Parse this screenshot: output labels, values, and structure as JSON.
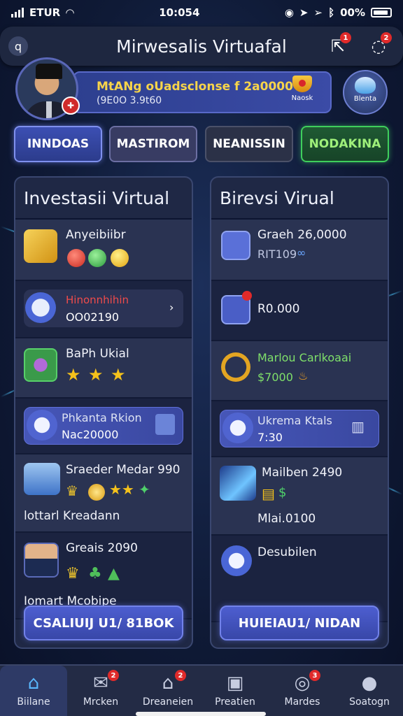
{
  "status_bar": {
    "carrier": "ETUR",
    "time": "10:054",
    "battery": "00%"
  },
  "header": {
    "title": "Mirwesalis Virtuafal",
    "back_icon": "q",
    "badge_count_1": "1",
    "badge_count_2": "2"
  },
  "profile": {
    "line1": "MtANg oUadsclonse f 2a0000",
    "line2": "(9E0O 3.9t60",
    "trophy_label": "Naosk",
    "badge_label": "Blenta",
    "avatar_badge_icon": "shield"
  },
  "tabs": [
    "INNDOAS",
    "MASTIROM",
    "NEANISSIN",
    "NODAKINA"
  ],
  "left_panel": {
    "title": "Investasii Virtual",
    "rows": [
      {
        "title": "Anyeibiibr"
      },
      {
        "title": "Hinonnhihin",
        "subtitle": "OO02190",
        "title_color": "#e03a3a"
      },
      {
        "title": "BaPh Ukial"
      },
      {
        "title": "Phkanta Rkion",
        "subtitle": "Nac20000"
      },
      {
        "title": "Sraeder Medar 990",
        "subtitle": "lottarl Kreadann"
      },
      {
        "title": "Greais 2090",
        "subtitle": "Iomart Mcobipe"
      }
    ],
    "button": "CSALIUIJ U1/ 81BOK"
  },
  "right_panel": {
    "title": "Birevsi Virual",
    "rows": [
      {
        "title": "Graeh 26,0000",
        "subtitle": "RIT109"
      },
      {
        "title": "R0.000"
      },
      {
        "title": "Marlou Carlkoaai",
        "subtitle": "$7000",
        "title_color": "#7fe06a",
        "subtitle_color": "#7fe06a"
      },
      {
        "title": "Ukrema Ktals",
        "subtitle": "7:30"
      },
      {
        "title": "Mailben 2490",
        "subtitle": "Mlai.0100"
      },
      {
        "title": "Desubilen"
      }
    ],
    "button": "HUIEIAU1/ NIDAN"
  },
  "bottom_nav": [
    {
      "label": "Biilane",
      "icon": "home-icon",
      "active": true
    },
    {
      "label": "Mrcken",
      "icon": "mail-icon",
      "badge": "2"
    },
    {
      "label": "Dreaneien",
      "icon": "house-icon",
      "badge": "2"
    },
    {
      "label": "Preatien",
      "icon": "briefcase-icon"
    },
    {
      "label": "Mardes",
      "icon": "target-icon",
      "badge": "3"
    },
    {
      "label": "Soatogn",
      "icon": "person-icon"
    }
  ],
  "colors": {
    "accent": "#4d5ed0",
    "green": "#3fcf5c",
    "gold": "#f7d44a",
    "red": "#e02a2a"
  }
}
